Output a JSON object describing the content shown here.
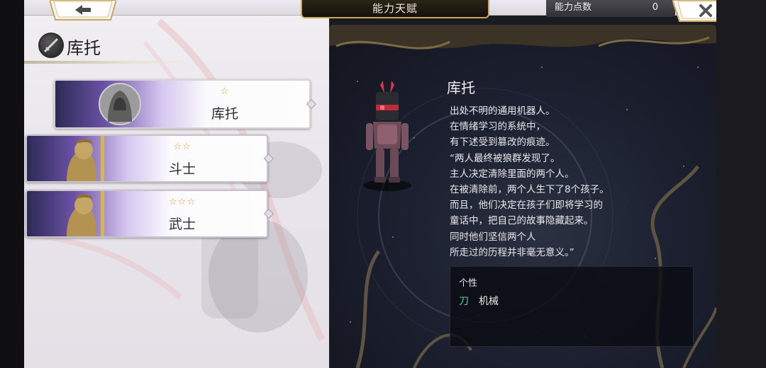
{
  "header": {
    "title": "能力天赋",
    "points_label": "能力点数",
    "points_value": "0"
  },
  "character": {
    "name": "库托"
  },
  "classes": [
    {
      "stars": "☆",
      "label": "库托",
      "selected": true
    },
    {
      "stars": "☆☆",
      "label": "斗士",
      "selected": false
    },
    {
      "stars": "☆☆☆",
      "label": "武士",
      "selected": false
    }
  ],
  "detail": {
    "name": "库托",
    "description": [
      "出处不明的通用机器人。",
      "在情绪学习的系统中，",
      "有下述受到篡改的痕迹。",
      "“两人最终被狼群发现了。",
      "主人决定清除里面的两个人。",
      "在被清除前，两个人生下了8个孩子。",
      "而且，他们决定在孩子们即将学习的",
      "童话中，把自己的故事隐藏起来。",
      "同时他们坚信两个人",
      "所走过的历程并非毫无意义。”"
    ],
    "traits_title": "个性",
    "trait_icon": "刀",
    "trait_label": "机械"
  },
  "colors": {
    "gold": "#c9a85a",
    "star": "#d6a035",
    "trait_accent": "#5cc8a8"
  }
}
